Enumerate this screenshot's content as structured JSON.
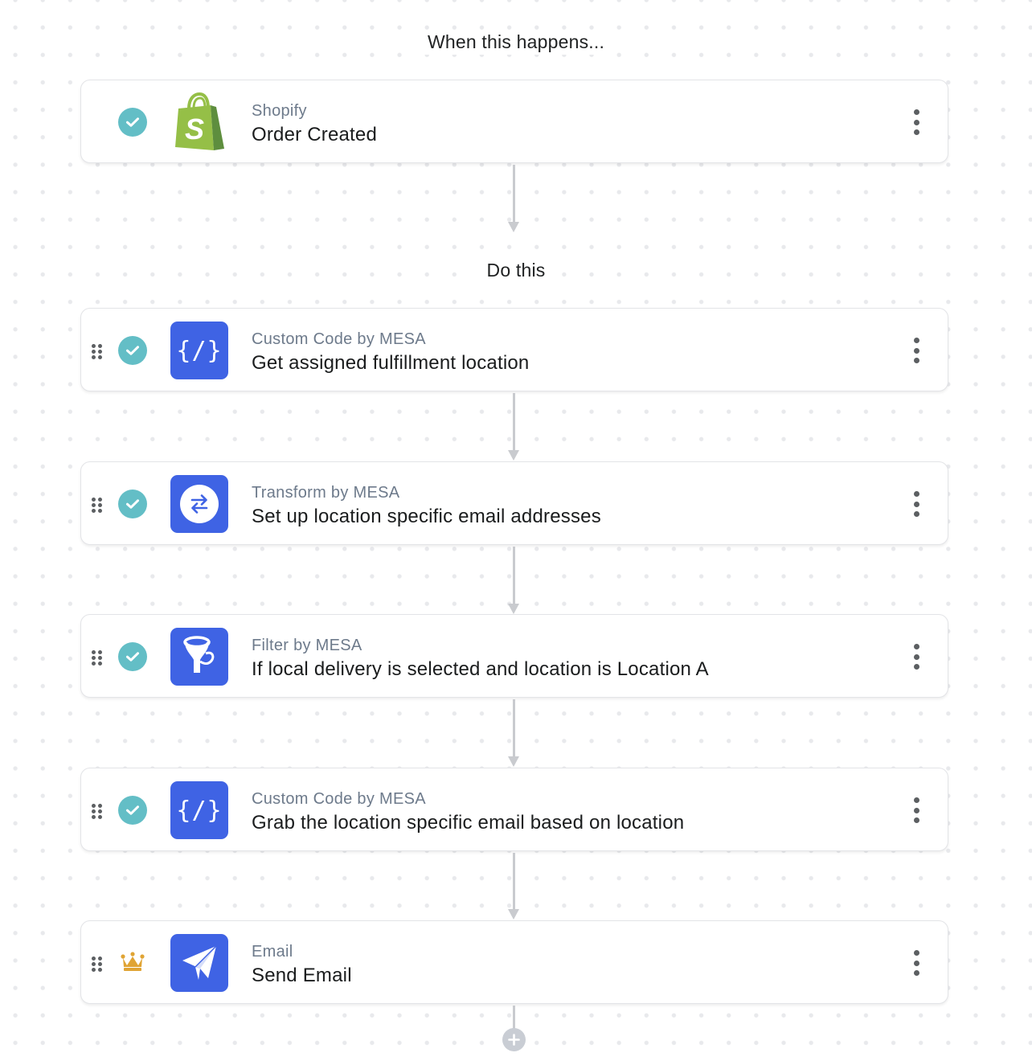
{
  "trigger_section": {
    "label": "When this happens...",
    "step": {
      "status": "complete",
      "status_icon": "check-circle-icon",
      "app_icon": "shopify-bag-icon",
      "app_name": "Shopify",
      "title": "Order Created",
      "menu_icon": "kebab-menu-icon"
    }
  },
  "action_section": {
    "label": "Do this",
    "steps": [
      {
        "status": "complete",
        "status_icon": "check-circle-icon",
        "app_icon": "custom-code-icon",
        "icon_glyph": "{/}",
        "app_name": "Custom Code by MESA",
        "title": "Get assigned fulfillment location",
        "menu_icon": "kebab-menu-icon"
      },
      {
        "status": "complete",
        "status_icon": "check-circle-icon",
        "app_icon": "transform-icon",
        "app_name": "Transform by MESA",
        "title": "Set up location specific email addresses",
        "menu_icon": "kebab-menu-icon"
      },
      {
        "status": "complete",
        "status_icon": "check-circle-icon",
        "app_icon": "filter-funnel-icon",
        "app_name": "Filter by MESA",
        "title": "If local delivery is selected and location is Location A",
        "menu_icon": "kebab-menu-icon"
      },
      {
        "status": "complete",
        "status_icon": "check-circle-icon",
        "app_icon": "custom-code-icon",
        "icon_glyph": "{/}",
        "app_name": "Custom Code by MESA",
        "title": "Grab the location specific email based on location",
        "menu_icon": "kebab-menu-icon"
      },
      {
        "status": "premium",
        "status_icon": "crown-icon",
        "app_icon": "paper-plane-icon",
        "app_name": "Email",
        "title": "Send Email",
        "menu_icon": "kebab-menu-icon"
      }
    ]
  },
  "add_step": {
    "icon": "plus-icon"
  },
  "colors": {
    "accent_blue": "#3f63e4",
    "check_teal": "#63bec6",
    "crown_gold": "#e0a434",
    "shopify_green": "#95bf47",
    "connector_gray": "#c9cbcf",
    "app_name_gray": "#6d7a8b"
  }
}
